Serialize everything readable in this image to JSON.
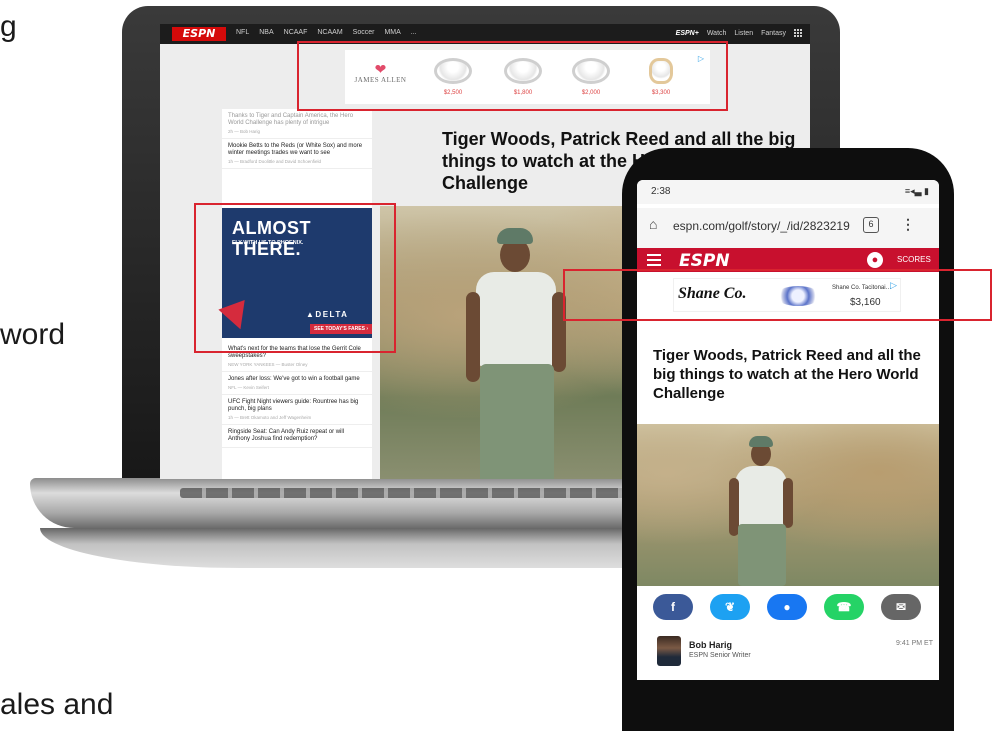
{
  "slide_fragments": [
    "g",
    "word",
    "ales and"
  ],
  "laptop": {
    "espn_logo": "ESPN",
    "nav_items": [
      "NFL",
      "NBA",
      "NCAAF",
      "NCAAM",
      "Soccer",
      "MMA",
      "..."
    ],
    "nav_right": [
      "ESPN+",
      "Watch",
      "Listen",
      "Fantasy"
    ],
    "grid_icon": "apps-grid-icon",
    "ad_jewelry": {
      "brand": "JAMES ALLEN",
      "prices": [
        "$2,500",
        "$1,800",
        "$2,000",
        "$3,300"
      ],
      "adchoices": "▷"
    },
    "sidebar_top": [
      {
        "title": "Thanks to Tiger and Captain America, the Hero World Challenge has plenty of intrigue",
        "meta": "2h — Bob Harig",
        "dim": true
      },
      {
        "title": "Mookie Betts to the Reds (or White Sox) and more winter meetings trades we want to see",
        "meta": "1h — Bradford Doolittle and David Schoenfield",
        "dim": false
      }
    ],
    "delta_ad": {
      "headline": "ALMOST THERE.",
      "sub": "FLY WITH US TO PHOENIX.",
      "brand": "▲DELTA",
      "cta": "SEE TODAY'S FARES ›"
    },
    "sidebar_bottom": [
      {
        "title": "What's next for the teams that lose the Gerrit Cole sweepstakes?",
        "meta": "NEW YORK YANKEES — Buster Olney"
      },
      {
        "title": "Jones after loss: We've got to win a football game",
        "meta": "NFL — Kevin Seifert"
      },
      {
        "title": "UFC Fight Night viewers guide: Rountree has big punch, big plans",
        "meta": "1h — Brett Okamoto and Jeff Wagenheim"
      },
      {
        "title": "Ringside Seat: Can Andy Ruiz repeat or will Anthony Joshua find redemption?",
        "meta": ""
      }
    ],
    "headline": "Tiger Woods, Patrick Reed and all the big things to watch at the Hero World Challenge"
  },
  "phone": {
    "status_time": "2:38",
    "status_right": "≡◂▃ ▮",
    "url": "espn.com/golf/story/_/id/2823219",
    "tab_count": "6",
    "espn_logo": "ESPN",
    "scores_label": "SCORES",
    "ad": {
      "brand": "Shane Co.",
      "title": "Shane Co. Tacitonai…",
      "price": "$3,160",
      "adchoices": "▷"
    },
    "headline": "Tiger Woods, Patrick Reed and all the big things to watch at the Hero World Challenge",
    "share": [
      {
        "name": "facebook-share-icon",
        "glyph": "f",
        "color": "#3b5998"
      },
      {
        "name": "twitter-share-icon",
        "glyph": "❦",
        "color": "#1da1f2"
      },
      {
        "name": "messenger-share-icon",
        "glyph": "●",
        "color": "#1877f2"
      },
      {
        "name": "whatsapp-share-icon",
        "glyph": "☎",
        "color": "#25d366"
      },
      {
        "name": "email-share-icon",
        "glyph": "✉",
        "color": "#666666"
      }
    ],
    "author": {
      "name": "Bob Harig",
      "role": "ESPN Senior Writer",
      "time": "9:41 PM ET"
    }
  },
  "colors": {
    "highlight": "#d9242f",
    "espn_red": "#c8102e",
    "delta_blue": "#1e3a6d"
  }
}
